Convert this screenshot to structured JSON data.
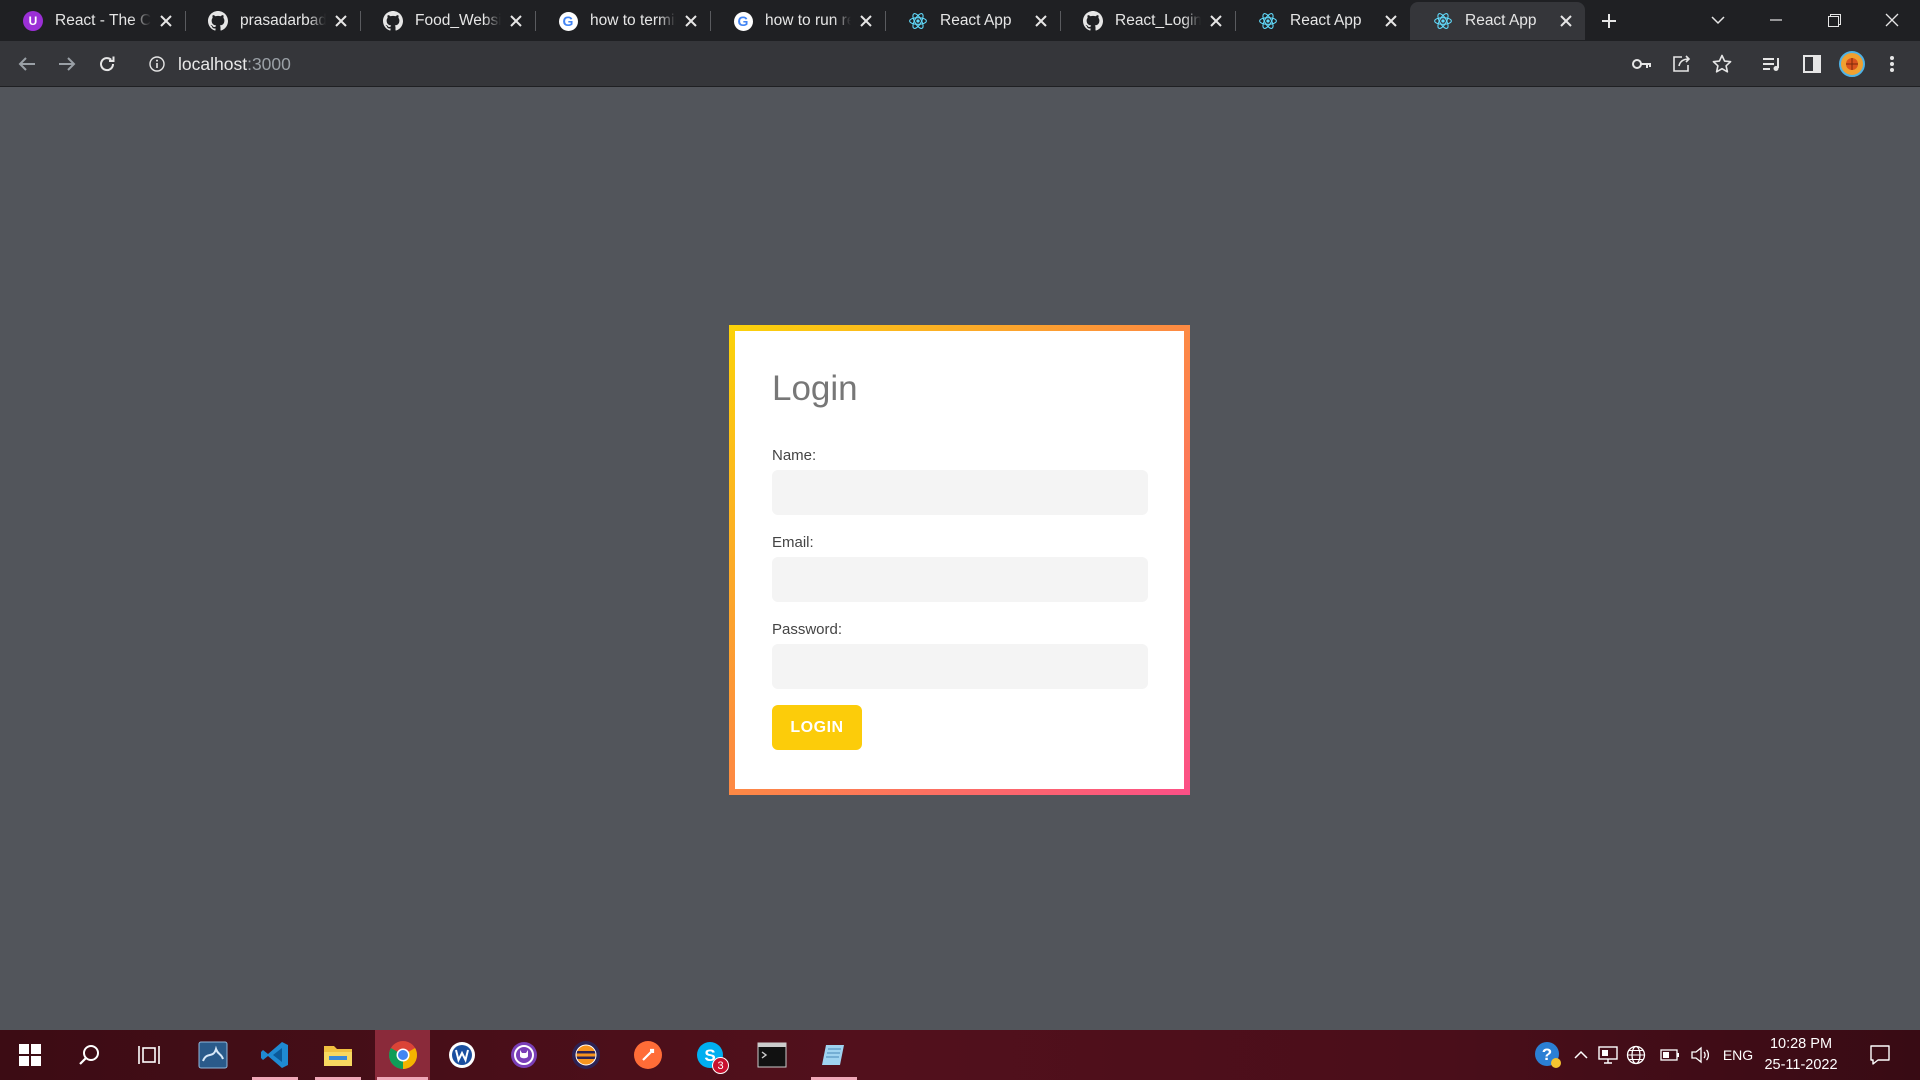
{
  "browser": {
    "tabs": [
      {
        "title": "React - The Co",
        "icon": "udemy-icon",
        "active": false
      },
      {
        "title": "prasadarbad/F",
        "icon": "github-icon",
        "active": false
      },
      {
        "title": "Food_Website",
        "icon": "github-icon",
        "active": false
      },
      {
        "title": "how to termin",
        "icon": "google-icon",
        "active": false
      },
      {
        "title": "how to run re",
        "icon": "google-icon",
        "active": false
      },
      {
        "title": "React App",
        "icon": "react-icon",
        "active": false
      },
      {
        "title": "React_Login_A",
        "icon": "github-icon",
        "active": false
      },
      {
        "title": "React App",
        "icon": "react-icon",
        "active": false
      },
      {
        "title": "React App",
        "icon": "react-icon",
        "active": true
      }
    ],
    "address": {
      "host": "localhost",
      "port": ":3000"
    }
  },
  "login": {
    "title": "Login",
    "name_label": "Name:",
    "email_label": "Email:",
    "password_label": "Password:",
    "name_value": "",
    "email_value": "",
    "password_value": "",
    "button_label": "LOGIN"
  },
  "taskbar": {
    "apps": [
      "start",
      "search",
      "task-view",
      "mysql-workbench",
      "vscode",
      "file-explorer",
      "chrome",
      "app-w",
      "github-desktop",
      "eclipse",
      "postman",
      "skype",
      "terminal",
      "notepad"
    ],
    "skype_badge": "3",
    "language": "ENG",
    "time": "10:28 PM",
    "date": "25-11-2022"
  },
  "colors": {
    "page_background": "#52555b",
    "card_gradient": [
      "#fbd309",
      "#fd8f3d",
      "#fc4f87"
    ],
    "button": "#fccc0a"
  }
}
